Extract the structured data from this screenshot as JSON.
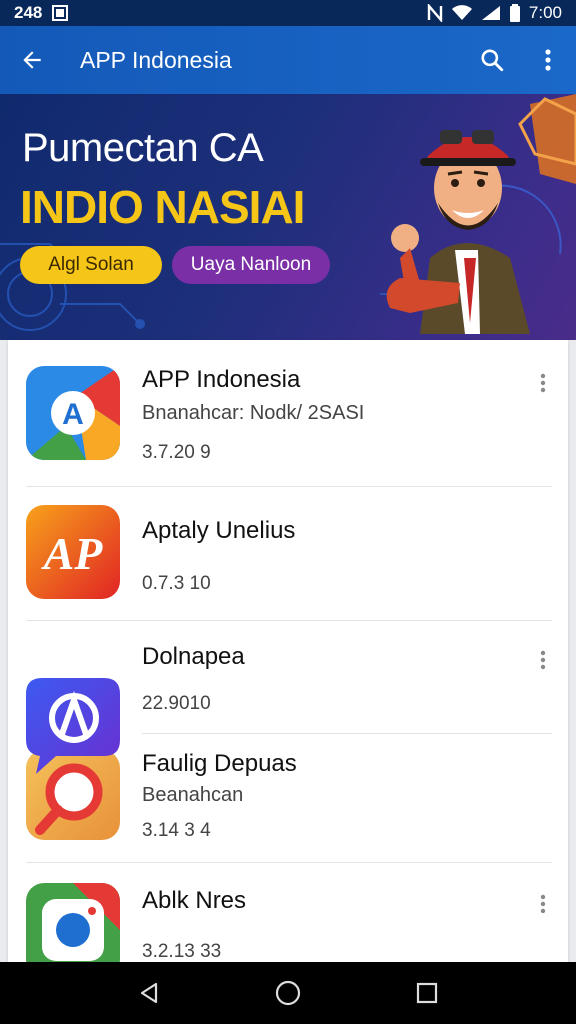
{
  "status_bar": {
    "left_icons": "248",
    "time": "7:00",
    "icons": [
      "nfc-icon",
      "wifi-icon",
      "signal-icon",
      "battery-icon"
    ]
  },
  "app_bar": {
    "title": "APP Indonesia",
    "icons": [
      "back-arrow-icon",
      "search-icon",
      "more-vert-icon"
    ]
  },
  "banner": {
    "headline": "Pumectan CA",
    "subheadline": "INDIO NASIAI",
    "chip_primary": "Algl Solan",
    "chip_secondary": "Uaya Nanloon",
    "colors": {
      "headline": "#ffffff",
      "subheadline": "#f5c518",
      "chip_primary_bg": "#f5c518",
      "chip_secondary_bg": "#7b2fa6"
    }
  },
  "apps": [
    {
      "name": "APP Indonesia",
      "subtitle": "Bnanahcar: Nodk/ 2SASI",
      "meta": "3.7.20 9",
      "icon": "app-a-icon",
      "has_menu": true
    },
    {
      "name": "Aptaly Unelius",
      "subtitle": "",
      "meta": "0.7.3 10",
      "icon": "app-ap-icon",
      "has_menu": false
    },
    {
      "name": "Dolnapea",
      "subtitle": "",
      "meta": "22.9010",
      "icon": "app-chat-icon",
      "has_menu": true
    },
    {
      "name": "Faulig Depuas",
      "subtitle": "Beanahcan",
      "meta": "3.14 3 4",
      "icon": "app-search-icon",
      "has_menu": false
    },
    {
      "name": "Ablk Nres",
      "subtitle": "",
      "meta": "3.2.13 33",
      "icon": "app-camera-icon",
      "has_menu": true
    }
  ],
  "nav_bar": {
    "icons": [
      "back-triangle-icon",
      "home-circle-icon",
      "recents-square-icon"
    ]
  }
}
